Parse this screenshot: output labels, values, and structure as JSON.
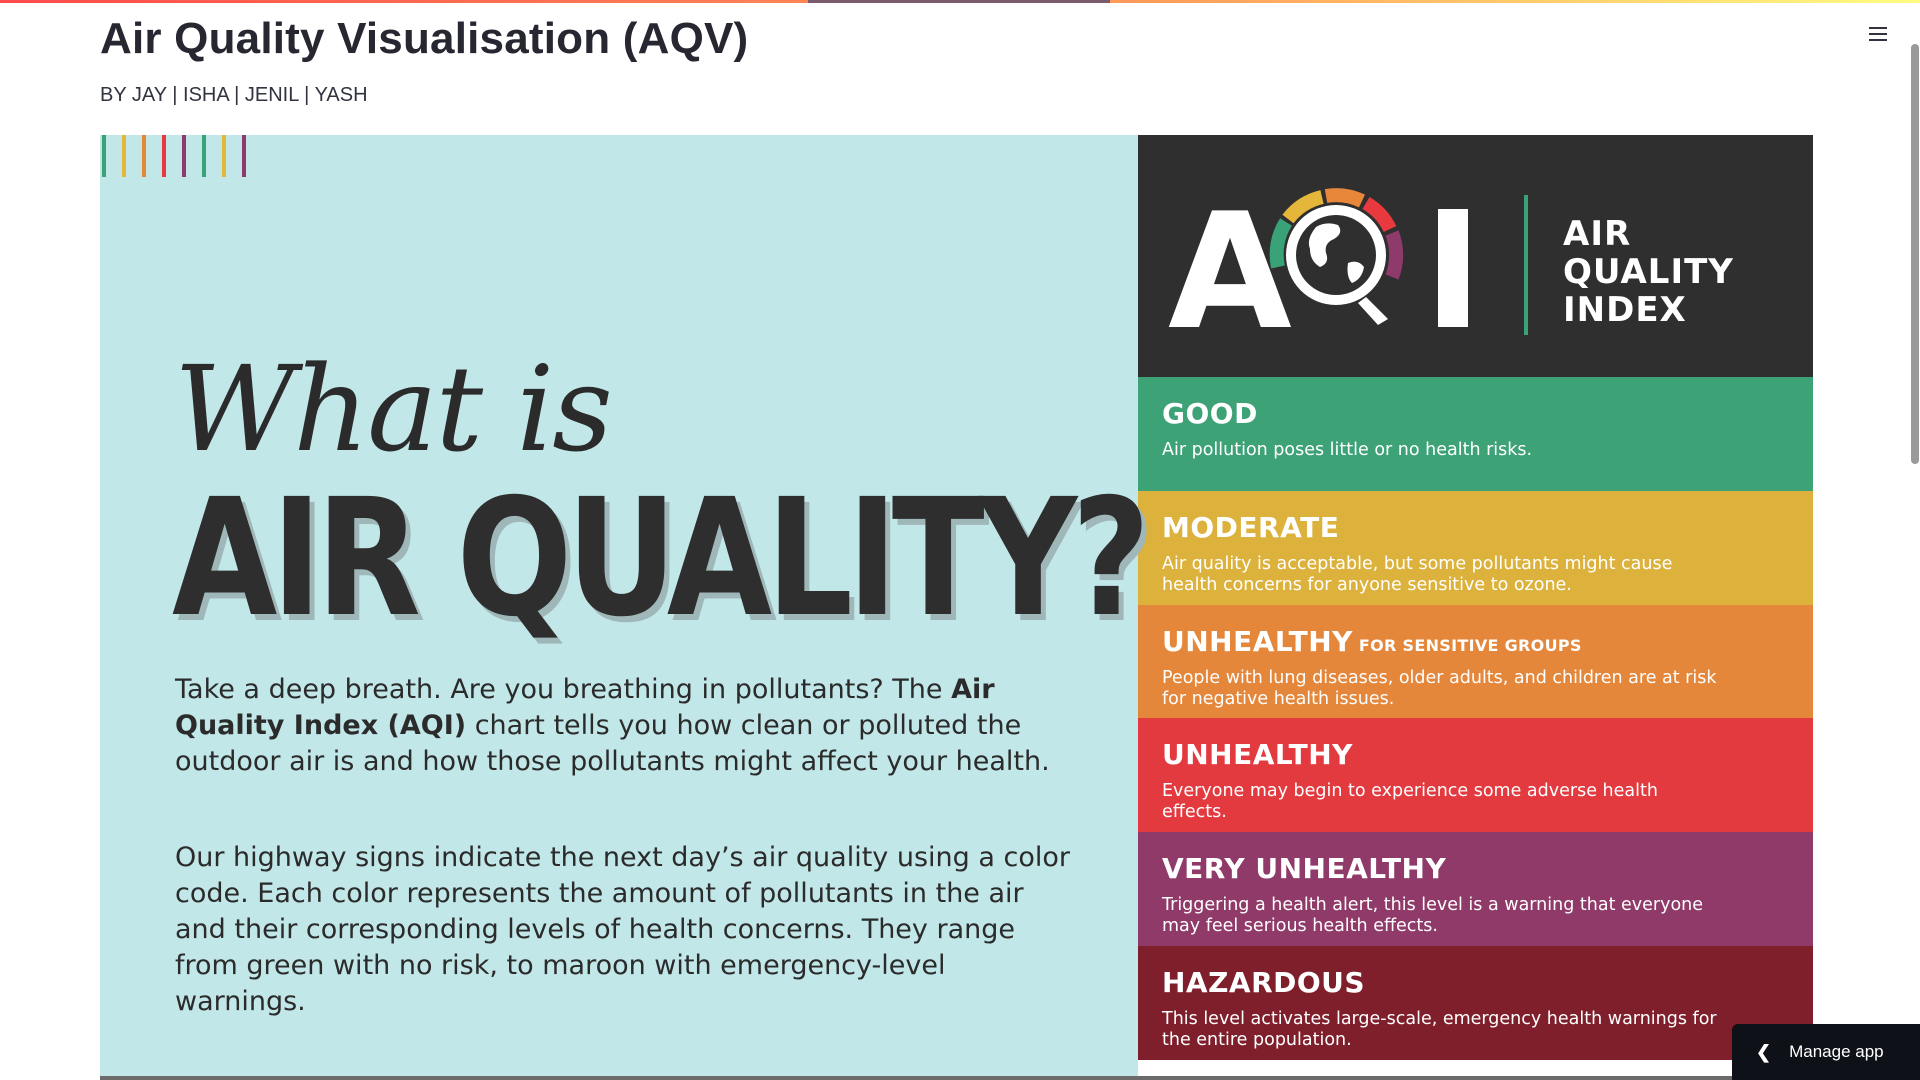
{
  "app": {
    "title": "Air Quality Visualisation (AQV)",
    "authors": "BY JAY | ISHA | JENIL | YASH",
    "menu_icon": "hamburger-icon",
    "manage_app_label": "Manage app",
    "manage_app_icon": "chevron-left-icon"
  },
  "infographic": {
    "stripe_colors": [
      "#3aa277",
      "#e4b63a",
      "#e8873a",
      "#e8393f",
      "#8e3a6a",
      "#3aa277",
      "#e4b63a",
      "#8e3a6a"
    ],
    "what_is": "What is",
    "headline": "AIR QUALITY?",
    "paragraph1": {
      "before": "Take a deep breath. Are you breathing in pollutants? The ",
      "bold": "Air Quality Index (AQI)",
      "after": " chart tells you how clean or polluted the outdoor air is and how those pollutants might affect your health."
    },
    "paragraph2": "Our highway signs indicate the next day’s air quality using a color code. Each color represents the amount of pollutants in the air and their corresponding levels of health concerns. They range from green with no risk, to maroon with emergency-level warnings.",
    "aqi_logo": "AQI",
    "aqi_label": [
      "AIR",
      "QUALITY",
      "INDEX"
    ],
    "levels": [
      {
        "name": "GOOD",
        "suffix": "",
        "color": "#3ea277",
        "desc": "Air pollution poses little or no health risks."
      },
      {
        "name": "MODERATE",
        "suffix": "",
        "color": "#dcb23d",
        "desc": "Air quality is acceptable, but some pollutants might cause health concerns for anyone sensitive to ozone."
      },
      {
        "name": "UNHEALTHY",
        "suffix": "FOR SENSITIVE GROUPS",
        "color": "#e5873b",
        "desc": "People with lung diseases, older adults, and children are at risk for negative health issues."
      },
      {
        "name": "UNHEALTHY",
        "suffix": "",
        "color": "#e33a40",
        "desc": "Everyone may begin to experience some adverse health effects."
      },
      {
        "name": "VERY UNHEALTHY",
        "suffix": "",
        "color": "#8f3a68",
        "desc": "Triggering a health alert, this level is a warning that everyone may feel serious health effects."
      },
      {
        "name": "HAZARDOUS",
        "suffix": "",
        "color": "#7f1f2c",
        "desc": "This level activates large-scale, emergency health warnings for the entire population."
      }
    ]
  }
}
